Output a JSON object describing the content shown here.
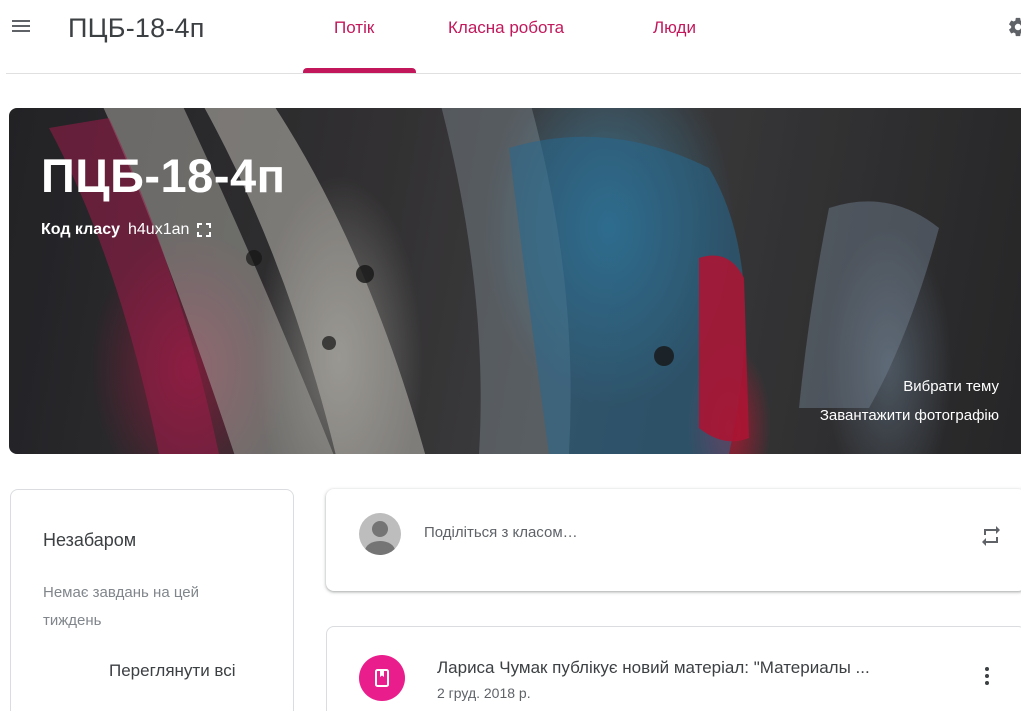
{
  "header": {
    "class_name": "ПЦБ-18-4п",
    "tabs": [
      {
        "label": "Потік",
        "active": true
      },
      {
        "label": "Класна робота",
        "active": false
      },
      {
        "label": "Люди",
        "active": false
      }
    ],
    "icons": {
      "menu": "hamburger-menu-icon",
      "settings": "gear-icon"
    }
  },
  "banner": {
    "title": "ПЦБ-18-4п",
    "class_code_label": "Код класу",
    "class_code": "h4ux1an",
    "select_theme": "Вибрати тему",
    "upload_photo": "Завантажити фотографію"
  },
  "upcoming": {
    "title": "Незабаром",
    "empty_text": "Немає завдань на цей тиждень",
    "view_all": "Переглянути всі"
  },
  "share": {
    "placeholder": "Поділіться з класом…",
    "icons": {
      "avatar": "user-avatar-icon",
      "repost": "repost-icon"
    }
  },
  "post": {
    "title": "Лариса Чумак публікує новий матеріал: \"Материалы ...",
    "date": "2 груд. 2018 р.",
    "icons": {
      "type": "book-icon",
      "more": "more-vert-icon"
    }
  },
  "colors": {
    "accent": "#c2185b",
    "post_icon_bg": "#e91e8c",
    "text_primary": "#3c4043",
    "text_secondary": "#80868b"
  }
}
